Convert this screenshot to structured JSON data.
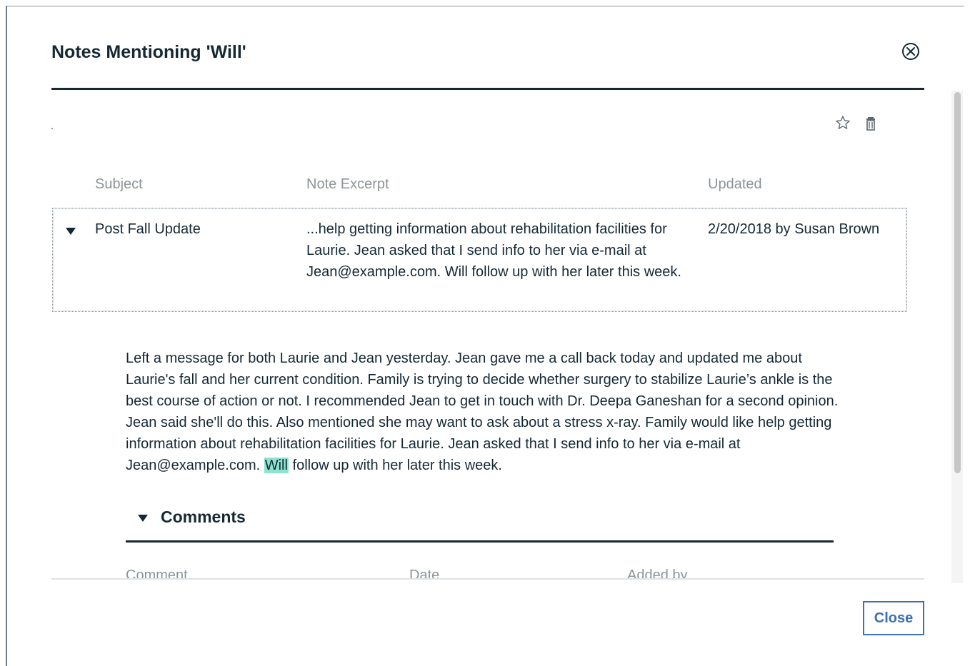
{
  "modal": {
    "title": "Notes Mentioning 'Will'",
    "close_icon": "close-circle-icon"
  },
  "toolbar": {
    "favorite_icon": "star-icon",
    "delete_icon": "trash-icon"
  },
  "table": {
    "headers": {
      "subject": "Subject",
      "excerpt": "Note Excerpt",
      "updated": "Updated"
    },
    "rows": [
      {
        "expanded": true,
        "subject": "Post Fall Update",
        "excerpt": "...help getting information about rehabilitation facilities for Laurie. Jean asked that I send info to her via e-mail at Jean@example.com. Will follow up with her later this week.",
        "updated": "2/20/2018 by Susan Brown"
      }
    ]
  },
  "note": {
    "body_before": "Left a message for both Laurie and Jean yesterday. Jean gave me a call back today and updated me about Laurie's fall and her current condition. Family is trying to decide whether surgery to stabilize Laurie’s ankle is the best course of action or not. I recommended Jean to get in touch with Dr. Deepa Ganeshan for a second opinion. Jean said she'll do this. Also mentioned she may want to ask about a stress x-ray. Family would like help getting information about rehabilitation facilities for Laurie. Jean asked that I send info to her via e-mail at Jean@example.com. ",
    "highlight": "Will",
    "body_after": " follow up with her later this week.",
    "highlight_color": "#8ee3cf"
  },
  "comments": {
    "label": "Comments",
    "expanded": true,
    "headers": {
      "comment": "Comment",
      "date": "Date",
      "added_by": "Added by"
    }
  },
  "footer": {
    "close_label": "Close"
  },
  "colors": {
    "text": "#152935",
    "muted": "#8c9499",
    "accent": "#3d70b2"
  }
}
